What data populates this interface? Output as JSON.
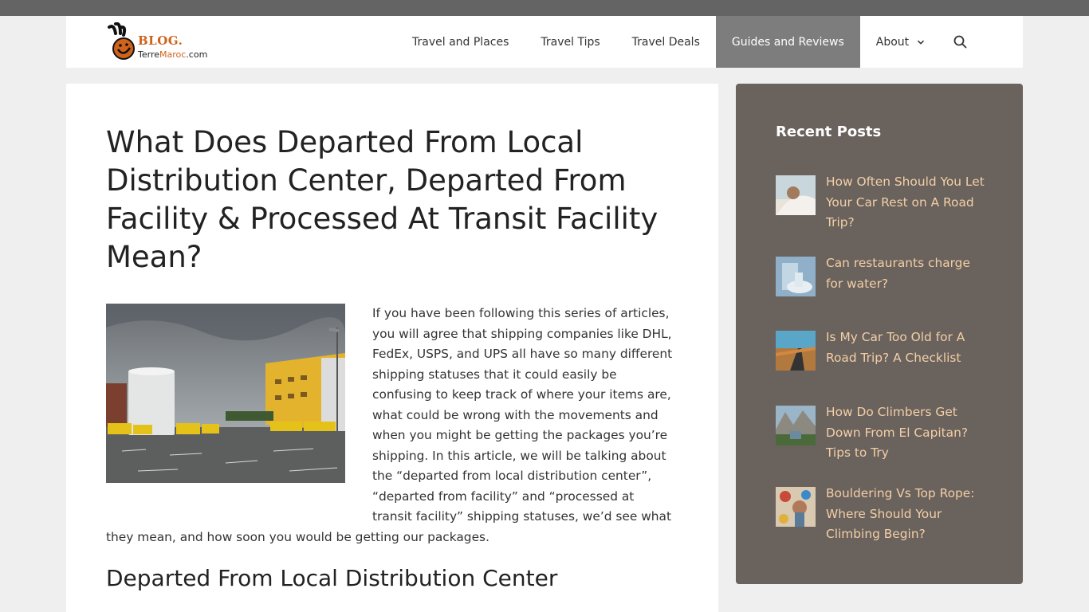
{
  "header": {
    "logo": {
      "line1": "BLOG.",
      "line2_a": "Terre",
      "line2_b": "Maroc",
      "line2_c": ".com"
    },
    "nav": [
      {
        "label": "Travel and Places"
      },
      {
        "label": "Travel Tips"
      },
      {
        "label": "Travel Deals"
      },
      {
        "label": "Guides and Reviews",
        "active": true
      },
      {
        "label": "About"
      }
    ]
  },
  "article": {
    "title": "What Does Departed From Local Distribution Center, Departed From Facility & Processed At Transit Facility Mean?",
    "intro": "If you have been following this series of articles, you will agree that shipping companies like DHL, FedEx, USPS, and UPS all have so many different shipping statuses that it could easily be confusing to keep track of where your items are, what could be wrong with the movements and when you might be getting the packages you’re shipping. In this article, we will be talking about the “departed from local distribution center”, “departed from facility” and “processed at transit facility” shipping statuses, we’d see what they mean, and how soon you would be getting our packages.",
    "section_heading": "Departed From Local Distribution Center"
  },
  "sidebar": {
    "title": "Recent Posts",
    "posts": [
      {
        "title": "How Often Should You Let Your Car Rest on A Road Trip?"
      },
      {
        "title": "Can restaurants charge for water?"
      },
      {
        "title": "Is My Car Too Old for A Road Trip? A Checklist"
      },
      {
        "title": "How Do Climbers Get Down From El Capitan? Tips to Try"
      },
      {
        "title": "Bouldering Vs Top Rope: Where Should Your Climbing Begin?"
      }
    ]
  },
  "colors": {
    "topbar": "#646464",
    "active_nav": "#7d7d7d",
    "sidebar_bg": "#6a625d",
    "sidebar_link": "#f3cfa6",
    "logo_orange": "#d0631b"
  }
}
